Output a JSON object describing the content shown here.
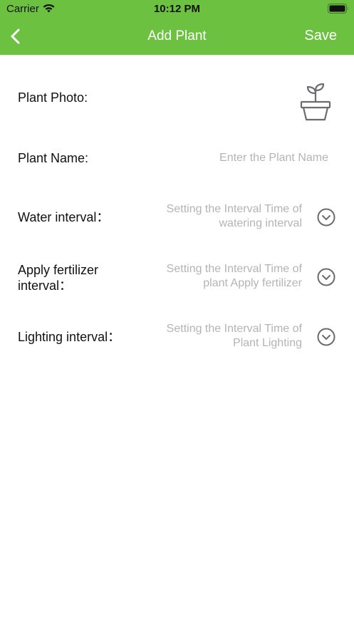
{
  "status_bar": {
    "carrier": "Carrier",
    "time": "10:12 PM",
    "icons": [
      "wifi-icon",
      "battery-icon"
    ]
  },
  "nav": {
    "title": "Add Plant",
    "save_label": "Save",
    "back_icon": "chevron-left-icon",
    "background_color": "#6cc140"
  },
  "form": {
    "photo": {
      "label": "Plant Photo:",
      "icon": "plant-pot-icon"
    },
    "name": {
      "label": "Plant Name:",
      "placeholder": "Enter the Plant Name",
      "value": ""
    },
    "water": {
      "label": "Water interval：",
      "value_line1": "Setting the Interval Time of",
      "value_line2": "watering interval",
      "icon": "chevron-down-circle-icon"
    },
    "fertilizer": {
      "label_line1": "Apply fertilizer",
      "label_line2": "interval：",
      "value_line1": "Setting the Interval Time of",
      "value_line2": "plant Apply fertilizer",
      "icon": "chevron-down-circle-icon"
    },
    "lighting": {
      "label": "Lighting interval：",
      "value_line1": "Setting the Interval Time of",
      "value_line2": "Plant Lighting",
      "icon": "chevron-down-circle-icon"
    }
  },
  "colors": {
    "accent": "#6cc140",
    "placeholder": "#b4b4b4",
    "icon_gray": "#6b6b70"
  }
}
